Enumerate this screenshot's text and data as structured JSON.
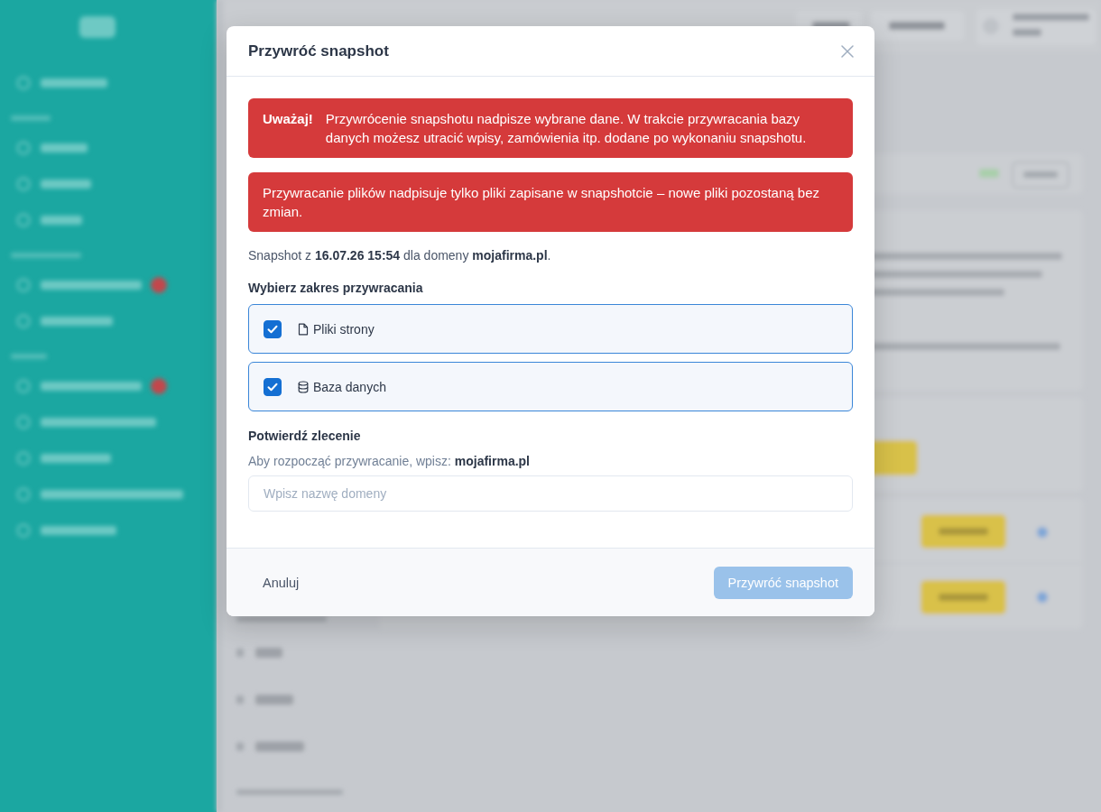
{
  "dialog": {
    "title": "Przywróć snapshot",
    "alerts": [
      {
        "kind": "labeled",
        "label": "Uważaj!",
        "text": "Przywrócenie snapshotu nadpisze wybrane dane. W trakcie przywracania bazy danych możesz utracić wpisy, zamówienia itp. dodane po wykonaniu snapshotu."
      },
      {
        "kind": "plain",
        "text": "Przywracanie plików nadpisuje tylko pliki zapisane w snapshotcie – nowe pliki pozostaną bez zmian."
      }
    ],
    "info": "Snapshot z **16.07.26 15:54** dla domeny **mojafirma.pl**.",
    "scope": {
      "heading": "Wybierz zakres przywracania",
      "options": [
        {
          "kind": "files",
          "label": "Pliki strony",
          "checked": true
        },
        {
          "kind": "database",
          "label": "Baza danych",
          "checked": true
        }
      ]
    },
    "confirm": {
      "heading": "Potwierdź zlecenie",
      "hint": "Aby rozpocząć przywracanie, wpisz: **mojafirma.pl**",
      "placeholder": "Wpisz nazwę domeny"
    },
    "buttons": [
      {
        "kind": "secondary",
        "label": "Anuluj",
        "disabled": false
      },
      {
        "kind": "primary",
        "label": "Przywróć snapshot",
        "disabled": true
      }
    ]
  }
}
